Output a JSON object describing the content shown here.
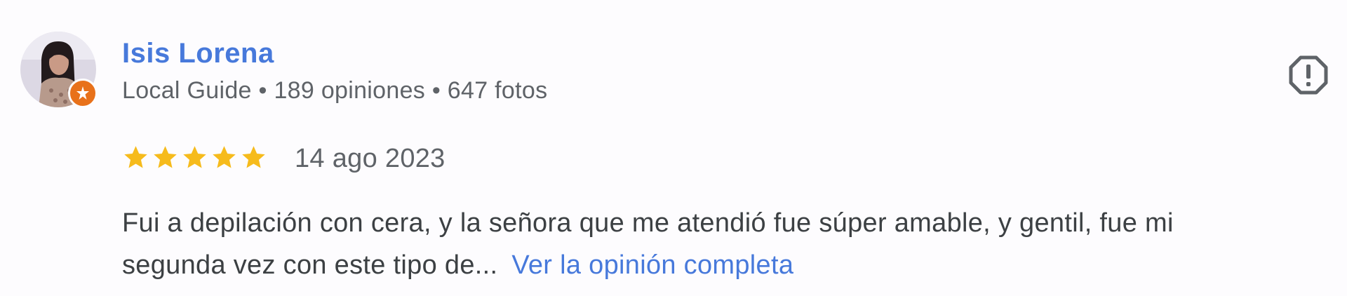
{
  "reviewer": {
    "name": "Isis Lorena",
    "meta": "Local Guide • 189 opiniones • 647 fotos",
    "badge_icon": "local-guide-star-icon",
    "badge_color": "#e8711a"
  },
  "review": {
    "rating": 5,
    "max_rating": 5,
    "date": "14 ago 2023",
    "text_line1": "Fui a depilación con cera, y la señora que me atendió fue súper amable, y gentil, fue mi",
    "text_line2": "segunda vez con este tipo de...",
    "read_more_label": "Ver la opinión completa"
  },
  "actions": {
    "report_icon": "report-exclamation-icon"
  },
  "colors": {
    "link": "#4779db",
    "star": "#f6bb1c",
    "secondary_text": "#5f6368",
    "body_text": "#3c4043"
  }
}
